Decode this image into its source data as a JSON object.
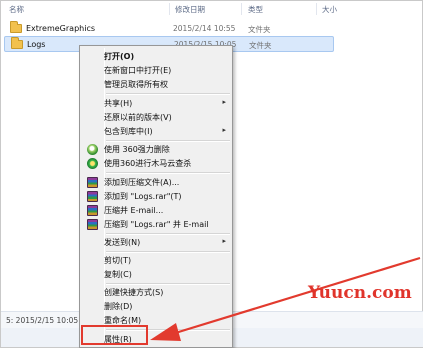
{
  "columns": {
    "name": "名称",
    "date": "修改日期",
    "type": "类型",
    "size": "大小"
  },
  "files": [
    {
      "name": "ExtremeGraphics",
      "date": "2015/2/14 10:55",
      "type": "文件夹",
      "selected": false,
      "icon": "folder-icon"
    },
    {
      "name": "Logs",
      "date": "2015/2/15 10:05",
      "type": "文件夹",
      "selected": true,
      "icon": "folder-icon"
    }
  ],
  "context_menu": {
    "open": "打开(O)",
    "open_new_window": "在新窗口中打开(E)",
    "take_ownership": "管理员取得所有权",
    "share": "共享(H)",
    "restore_versions": "还原以前的版本(V)",
    "include_in_library": "包含到库中(I)",
    "force_delete_360": "使用 360强力删除",
    "trojan_scan_360": "使用360进行木马云查杀",
    "add_to_archive": "添加到压缩文件(A)...",
    "add_to_logs_rar": "添加到 \"Logs.rar\"(T)",
    "compress_email": "压缩并 E-mail...",
    "compress_logs_email": "压缩到 \"Logs.rar\" 并 E-mail",
    "send_to": "发送到(N)",
    "cut": "剪切(T)",
    "copy": "复制(C)",
    "create_shortcut": "创建快捷方式(S)",
    "delete": "删除(D)",
    "rename": "重命名(M)",
    "properties": "属性(R)",
    "submenu_arrow": "▸"
  },
  "status": {
    "date_text": "5: 2015/2/15 10:05"
  },
  "watermark": "Yuucn.com",
  "colors": {
    "highlight": "#e23a2e",
    "selection": "#d9e8fb",
    "watermark": "#e0342b"
  }
}
